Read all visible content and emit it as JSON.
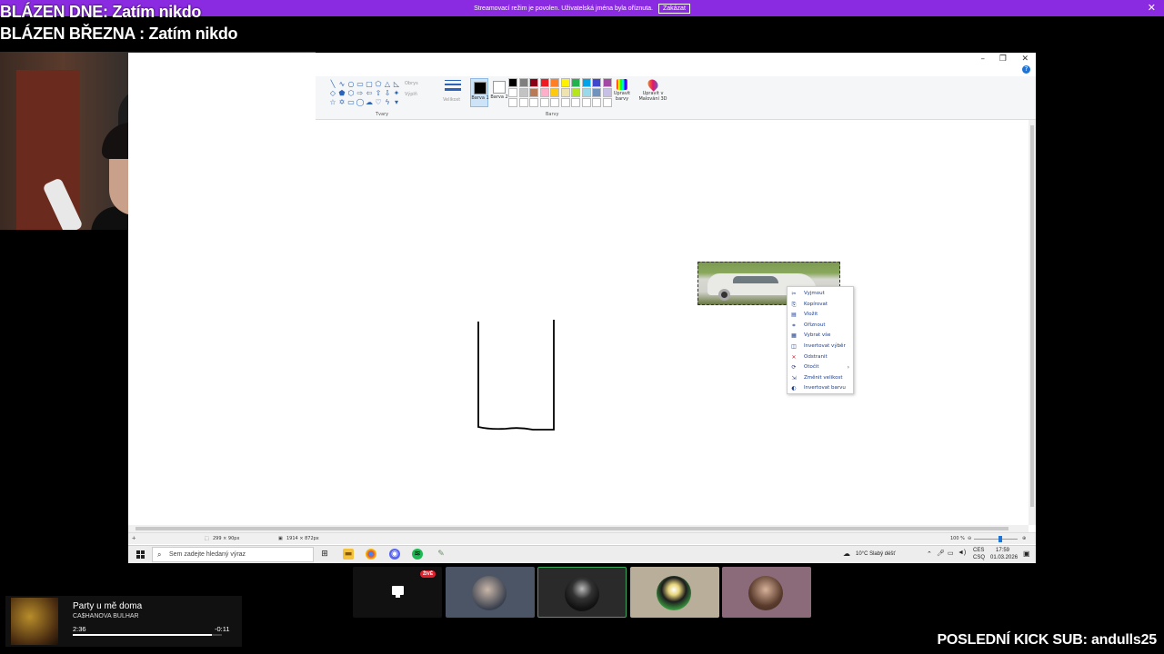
{
  "banner": {
    "message": "Streamovací režim je povolen. Uživatelská jména byla oříznuta.",
    "button_label": "Zakázat",
    "close_icon": "close-icon"
  },
  "overlay": {
    "line1": "BLÁZEN DNE: Zatím nikdo",
    "line2": "BLÁZEN BŘEZNA : Zatím nikdo",
    "sub_line": "POSLEDNÍ KICK SUB: andulls25"
  },
  "paint": {
    "ribbon": {
      "outline_label": "Obrys",
      "fill_label": "Výplň",
      "shapes_group": "Tvary",
      "size_label": "Velikost",
      "color1_label": "Barva 1",
      "color2_label": "Barva 2",
      "colors_group": "Barvy",
      "edit_colors_label": "Upravit barvy",
      "paint3d_label": "Upravit v Malování 3D",
      "color1": "#000000",
      "color2": "#ffffff",
      "palette": [
        "#000000",
        "#7f7f7f",
        "#880015",
        "#ed1c24",
        "#ff7f27",
        "#fff200",
        "#22b14c",
        "#00a2e8",
        "#3f48cc",
        "#a349a4",
        "#ffffff",
        "#c3c3c3",
        "#b97a57",
        "#ffaec9",
        "#ffc90e",
        "#efe4b0",
        "#b5e61d",
        "#99d9ea",
        "#7092be",
        "#c8bfe7",
        "#ffffff",
        "#ffffff",
        "#ffffff",
        "#ffffff",
        "#ffffff",
        "#ffffff",
        "#ffffff",
        "#ffffff",
        "#ffffff",
        "#ffffff"
      ]
    },
    "context_menu": [
      {
        "label": "Vyjmout",
        "icon": "cut-icon",
        "glyph": "✂"
      },
      {
        "label": "Kopírovat",
        "icon": "copy-icon",
        "glyph": "⎘"
      },
      {
        "label": "Vložit",
        "icon": "paste-icon",
        "glyph": "▤"
      },
      {
        "label": "Oříznout",
        "icon": "crop-icon",
        "glyph": "⌗"
      },
      {
        "label": "Vybrat vše",
        "icon": "select-all-icon",
        "glyph": "▦"
      },
      {
        "label": "Invertovat výběr",
        "icon": "invert-selection-icon",
        "glyph": "◫"
      },
      {
        "label": "Odstranit",
        "icon": "delete-icon",
        "glyph": "✕"
      },
      {
        "label": "Otočit",
        "icon": "rotate-icon",
        "glyph": "⟳"
      },
      {
        "label": "Změnit velikost",
        "icon": "resize-icon",
        "glyph": "⇲"
      },
      {
        "label": "Invertovat barvu",
        "icon": "invert-color-icon",
        "glyph": "◐"
      }
    ],
    "status": {
      "selection_size": "299 × 90px",
      "image_size": "1914 × 872px",
      "zoom": "100 %"
    }
  },
  "taskbar": {
    "search_placeholder": "Sem zadejte hledaný výraz",
    "weather": "10°C  Slabý déšť",
    "lang1": "CES",
    "lang2": "CSQ",
    "time": "17:59",
    "date": "01.03.2026"
  },
  "call": {
    "live_badge": "ŽIVĚ"
  },
  "player": {
    "song": "Party u mě doma",
    "artist": "CA$HANOVA BULHAR",
    "current": "2:36",
    "remaining": "-0:11",
    "progress": 0.93
  }
}
